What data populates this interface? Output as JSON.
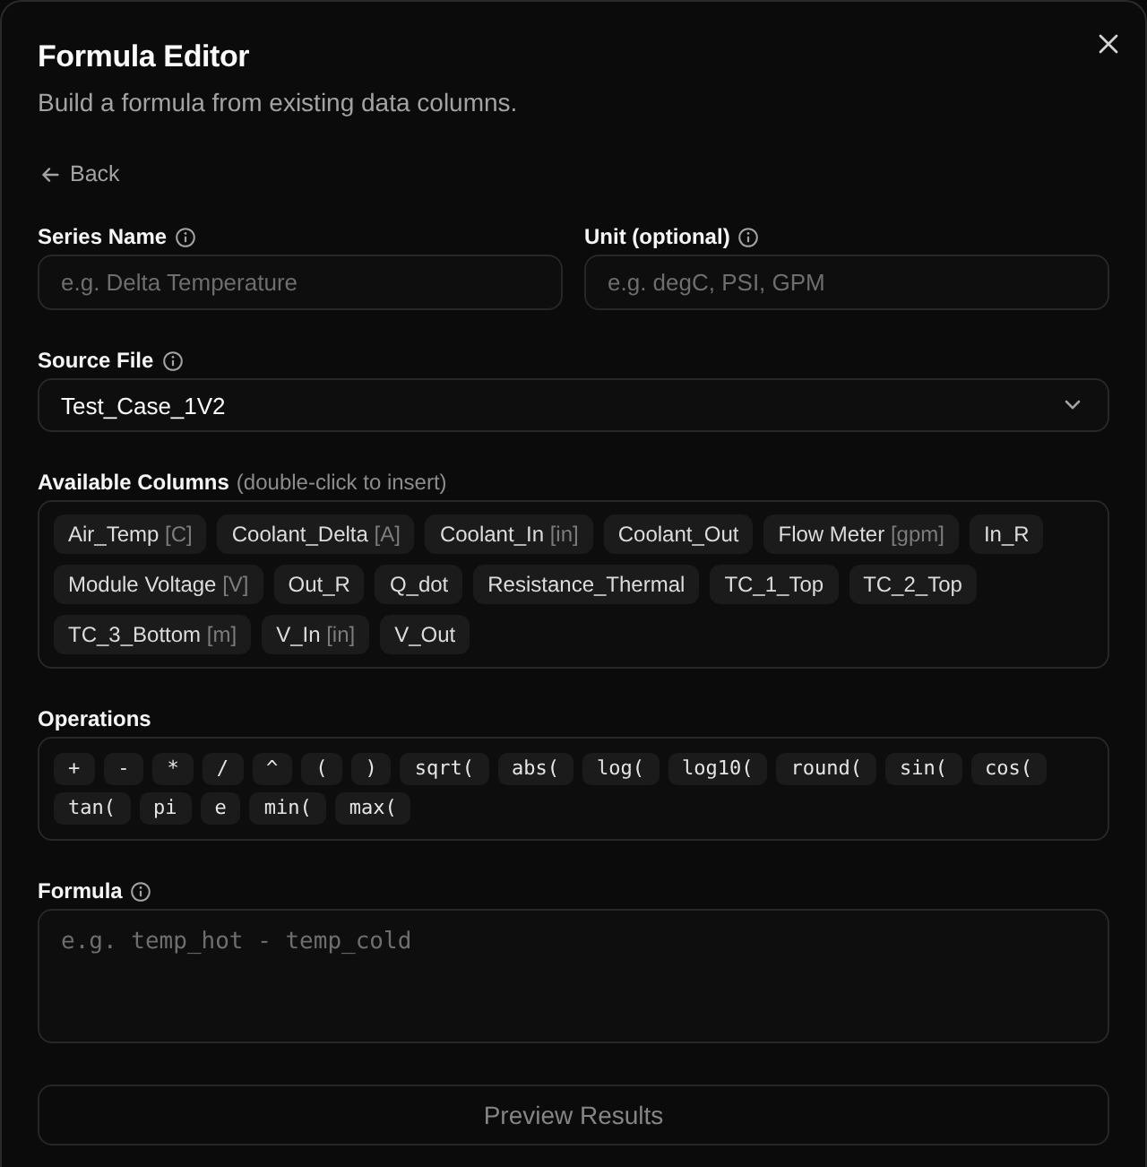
{
  "dialog": {
    "title": "Formula Editor",
    "subtitle": "Build a formula from existing data columns."
  },
  "back_link": {
    "label": "Back"
  },
  "fields": [
    {
      "label": "Series Name",
      "info": true,
      "placeholder": "e.g. Delta Temperature"
    },
    {
      "label": "Unit (optional)",
      "info": true,
      "placeholder": "e.g. degC, PSI, GPM"
    }
  ],
  "source_file": {
    "label": "Source File",
    "info": true,
    "value": "Test_Case_1V2"
  },
  "available_columns": {
    "label": "Available Columns",
    "hint": "(double-click to insert)",
    "columns": [
      {
        "name": "Air_Temp",
        "unit": "[C]"
      },
      {
        "name": "Coolant_Delta",
        "unit": "[A]"
      },
      {
        "name": "Coolant_In",
        "unit": "[in]"
      },
      {
        "name": "Coolant_Out"
      },
      {
        "name": "Flow Meter",
        "unit": "[gpm]"
      },
      {
        "name": "In_R"
      },
      {
        "name": "Module Voltage",
        "unit": "[V]"
      },
      {
        "name": "Out_R"
      },
      {
        "name": "Q_dot"
      },
      {
        "name": "Resistance_Thermal"
      },
      {
        "name": "TC_1_Top"
      },
      {
        "name": "TC_2_Top"
      },
      {
        "name": "TC_3_Bottom",
        "unit": "[m]"
      },
      {
        "name": "V_In",
        "unit": "[in]"
      },
      {
        "name": "V_Out"
      }
    ]
  },
  "operations": {
    "label": "Operations",
    "items": [
      "+",
      "-",
      "*",
      "/",
      "^",
      "(",
      ")",
      "sqrt(",
      "abs(",
      "log(",
      "log10(",
      "round(",
      "sin(",
      "cos(",
      "tan(",
      "pi",
      "e",
      "min(",
      "max("
    ]
  },
  "formula": {
    "label": "Formula",
    "info": true,
    "placeholder": "e.g. temp_hot - temp_cold"
  },
  "preview_button": {
    "label": "Preview Results",
    "disabled": true
  }
}
